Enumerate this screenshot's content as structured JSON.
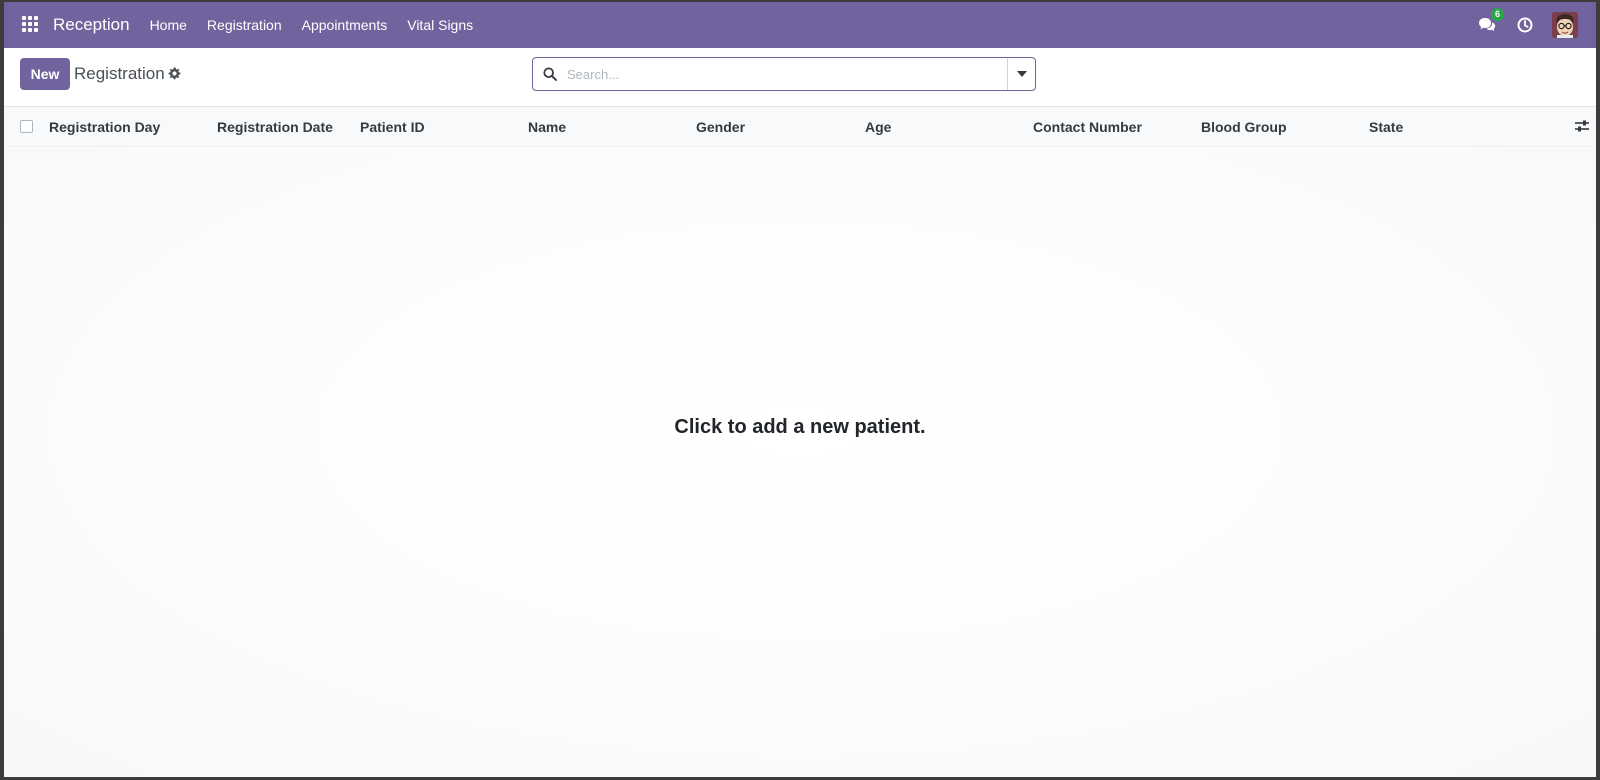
{
  "navbar": {
    "app_name": "Reception",
    "menu": [
      "Home",
      "Registration",
      "Appointments",
      "Vital Signs"
    ],
    "messages_count": "6",
    "accent_color": "#71639e",
    "badge_color": "#28a745"
  },
  "control_panel": {
    "new_label": "New",
    "title": "Registration"
  },
  "search": {
    "placeholder": "Search..."
  },
  "table": {
    "columns": [
      "Registration Day",
      "Registration Date",
      "Patient ID",
      "Name",
      "Gender",
      "Age",
      "Contact Number",
      "Blood Group",
      "State"
    ]
  },
  "empty_state": {
    "message": "Click to add a new patient."
  },
  "icons": [
    "apps-grid-icon",
    "chat-icon",
    "clock-icon",
    "avatar",
    "gear-icon",
    "search-icon",
    "caret-down-icon",
    "column-settings-icon"
  ]
}
